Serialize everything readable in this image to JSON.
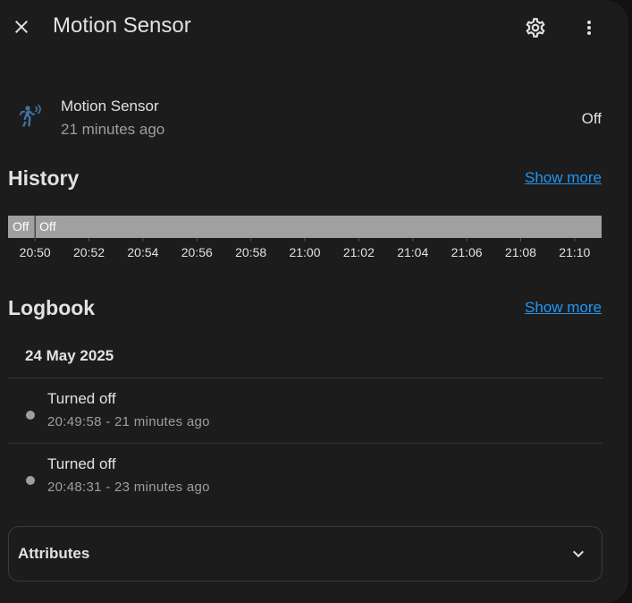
{
  "header": {
    "title": "Motion Sensor",
    "close_icon": "close-icon",
    "settings_icon": "gear-icon",
    "menu_icon": "more-vertical-icon"
  },
  "entity": {
    "name": "Motion Sensor",
    "last_changed": "21 minutes ago",
    "state": "Off",
    "icon": "motion-sensor-icon",
    "icon_color": "#44739e"
  },
  "history": {
    "title": "History",
    "show_more": "Show more",
    "chart_data": {
      "type": "timeline",
      "series": [
        {
          "segments": [
            {
              "label": "Off",
              "start": "20:49",
              "end": "20:50"
            },
            {
              "label": "Off",
              "start": "20:50",
              "end": "21:11"
            }
          ]
        }
      ],
      "x_range": [
        "20:49",
        "21:11"
      ],
      "ticks": [
        "20:50",
        "20:52",
        "20:54",
        "20:56",
        "20:58",
        "21:00",
        "21:02",
        "21:04",
        "21:06",
        "21:08",
        "21:10"
      ],
      "bar_color": "#a0a0a0"
    }
  },
  "logbook": {
    "title": "Logbook",
    "show_more": "Show more",
    "date": "24 May 2025",
    "entries": [
      {
        "message": "Turned off",
        "time": "20:49:58 - 21 minutes ago"
      },
      {
        "message": "Turned off",
        "time": "20:48:31 - 23 minutes ago"
      }
    ]
  },
  "attributes": {
    "label": "Attributes",
    "chevron_icon": "chevron-down-icon"
  },
  "colors": {
    "background": "#1c1c1c",
    "link": "#2196f3",
    "secondary_text": "#9e9e9e"
  }
}
